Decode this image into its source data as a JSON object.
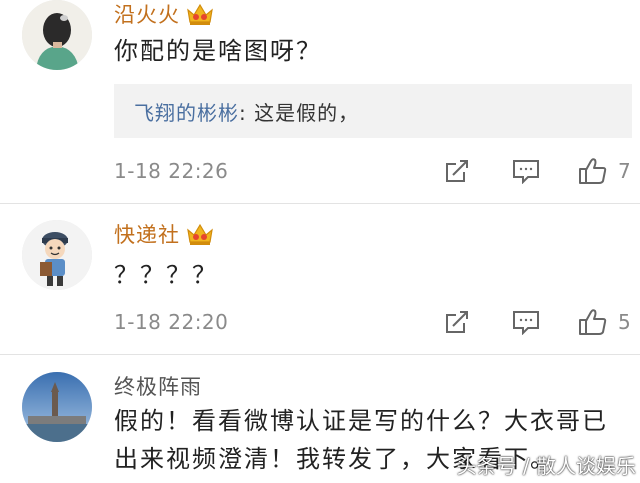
{
  "colors": {
    "vip_name": "#c2701d",
    "normal_name": "#555555",
    "reply_user": "#4a6fa0",
    "meta": "#8a8a8a"
  },
  "comments": [
    {
      "username": "沿火火",
      "vip": true,
      "avatar": "woman-back-avatar",
      "text": "你配的是啥图呀？",
      "reply": {
        "user": "飞翔的彬彬",
        "text": ": 这是假的，"
      },
      "time": "1-18 22:26",
      "likes": "7"
    },
    {
      "username": "快递社",
      "vip": true,
      "avatar": "courier-cartoon-avatar",
      "text": "？？？？",
      "time": "1-18 22:20",
      "likes": "5"
    },
    {
      "username": "终极阵雨",
      "vip": false,
      "avatar": "landscape-avatar",
      "text": "假的！看看微博认证是写的什么？大衣哥已出来视频澄清！我转发了，大家看下。"
    }
  ],
  "icons": {
    "share": "share-icon",
    "reply": "comment-icon",
    "like": "thumbs-up-icon",
    "vip": "crown-icon"
  },
  "watermark": "头条号 / 散人谈娱乐"
}
